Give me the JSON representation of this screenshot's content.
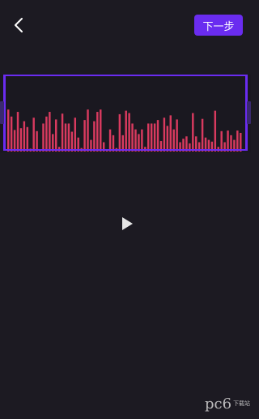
{
  "header": {
    "back_icon": "chevron-left-icon",
    "next_label": "下一步"
  },
  "waveform": {
    "bar_color": "#d93a5f",
    "frame_color": "#6a2cf0",
    "levels": [
      0.72,
      0.6,
      0.37,
      0.68,
      0.4,
      0.52,
      0.42,
      0.05,
      0.58,
      0.35,
      0.04,
      0.48,
      0.6,
      0.68,
      0.3,
      0.55,
      0.08,
      0.65,
      0.48,
      0.48,
      0.34,
      0.58,
      0.24,
      0.06,
      0.54,
      0.72,
      0.2,
      0.52,
      0.68,
      0.72,
      0.16,
      0.04,
      0.38,
      0.28,
      0.06,
      0.64,
      0.28,
      0.7,
      0.66,
      0.48,
      0.38,
      0.3,
      0.38,
      0.08,
      0.48,
      0.48,
      0.48,
      0.54,
      0.18,
      0.58,
      0.44,
      0.62,
      0.38,
      0.55,
      0.16,
      0.22,
      0.26,
      0.14,
      0.66,
      0.26,
      0.16,
      0.56,
      0.24,
      0.2,
      0.17,
      0.7,
      0.08,
      0.35,
      0.16,
      0.36,
      0.28,
      0.2,
      0.36,
      0.32
    ]
  },
  "player": {
    "play_icon": "play-icon"
  },
  "watermark": {
    "text": "pc6",
    "sub": "下载站"
  }
}
